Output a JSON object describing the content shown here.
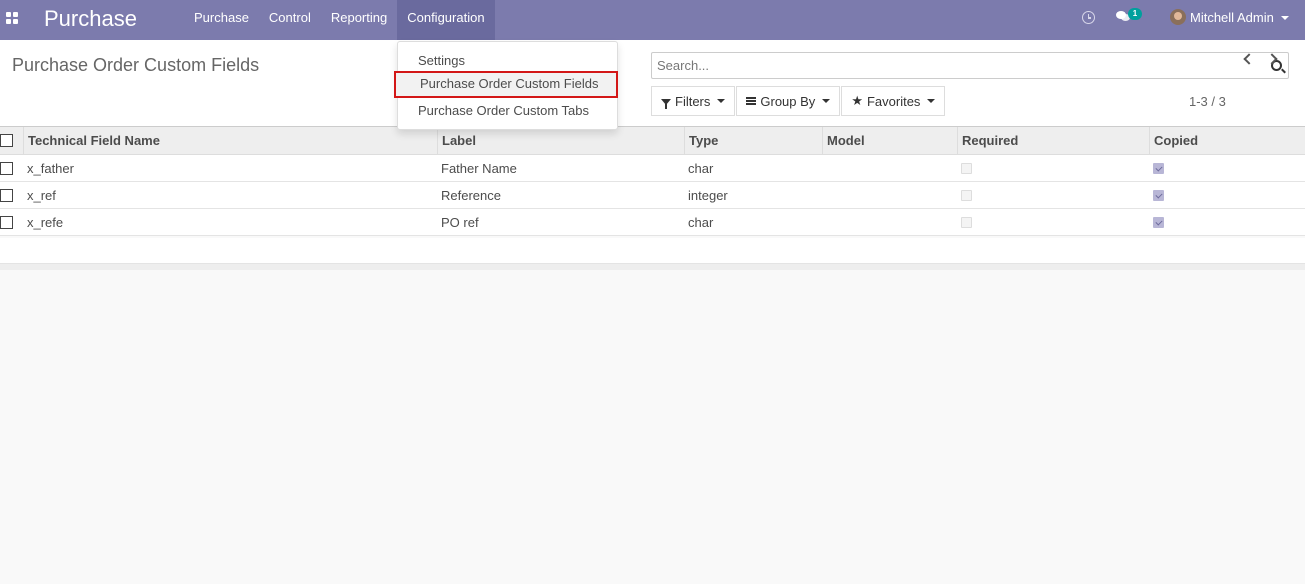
{
  "navbar": {
    "brand": "Purchase",
    "menu": [
      "Purchase",
      "Control",
      "Reporting",
      "Configuration"
    ],
    "active_menu": "Configuration",
    "messages_badge": "1",
    "user_name": "Mitchell Admin"
  },
  "control_panel": {
    "title": "Purchase Order Custom Fields",
    "search_placeholder": "Search...",
    "filters_label": "Filters",
    "group_by_label": "Group By",
    "favorites_label": "Favorites",
    "pager": "1-3 / 3"
  },
  "dropdown": {
    "items": [
      "Settings",
      "Purchase Order Custom Fields",
      "Purchase Order Custom Tabs"
    ],
    "highlighted": "Purchase Order Custom Fields"
  },
  "table": {
    "columns": [
      "Technical Field Name",
      "Label",
      "Type",
      "Model",
      "Required",
      "Copied"
    ],
    "rows": [
      {
        "name": "x_father",
        "label": "Father Name",
        "type": "char",
        "model": "",
        "required": false,
        "copied": true
      },
      {
        "name": "x_ref",
        "label": "Reference",
        "type": "integer",
        "model": "",
        "required": false,
        "copied": true
      },
      {
        "name": "x_refe",
        "label": "PO ref",
        "type": "char",
        "model": "",
        "required": false,
        "copied": true
      }
    ]
  },
  "colors": {
    "navbar": "#7c7bad",
    "highlight_border": "#d31717",
    "badge": "#00a09d"
  }
}
